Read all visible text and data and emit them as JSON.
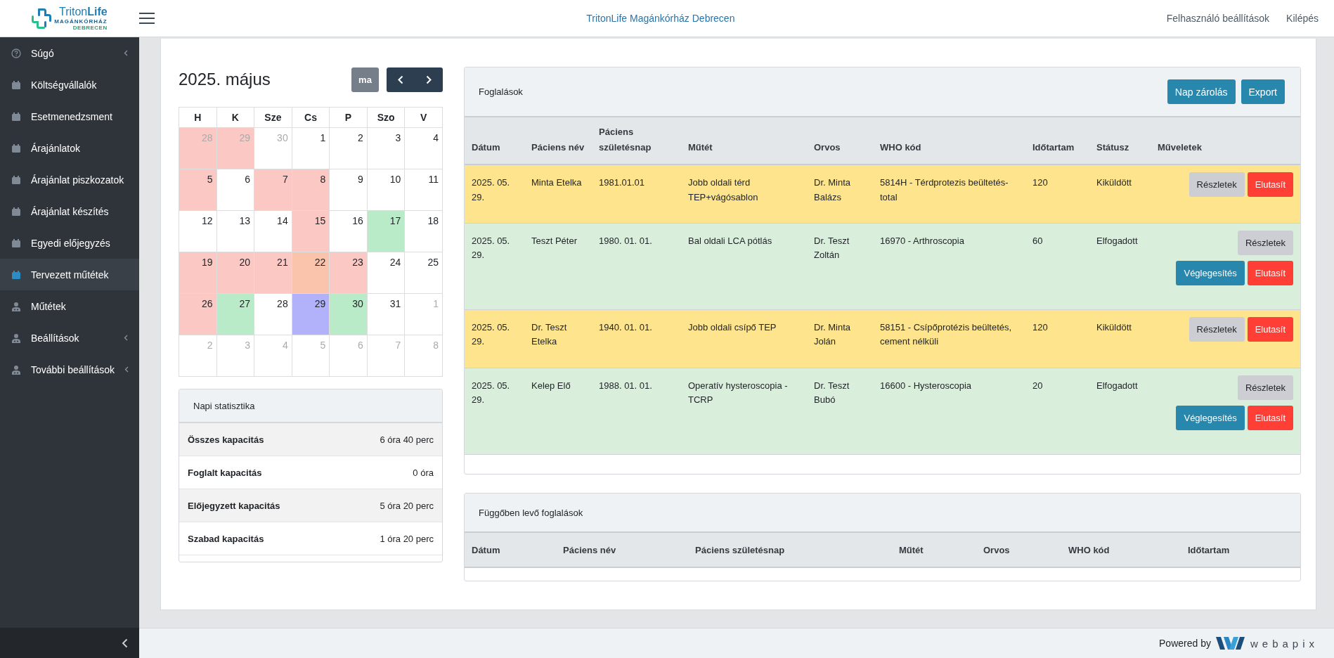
{
  "header": {
    "logo": {
      "name": "Triton**Life**",
      "subtitle": "MAGÁNKÓRHÁZ",
      "city": "DEBRECEN"
    },
    "title": "TritonLife Magánkórház Debrecen",
    "links": [
      "Felhasználó beállítások",
      "Kilépés"
    ]
  },
  "sidebar": {
    "items": [
      {
        "label": "Súgó",
        "kind": "help",
        "expandable": true,
        "selected": false
      },
      {
        "label": "Költségvállalók",
        "kind": "calendar",
        "expandable": false,
        "selected": false
      },
      {
        "label": "Esetmenedzsment",
        "kind": "calendar",
        "expandable": false,
        "selected": false
      },
      {
        "label": "Árajánlatok",
        "kind": "calendar",
        "expandable": false,
        "selected": false
      },
      {
        "label": "Árajánlat piszkozatok",
        "kind": "calendar",
        "expandable": false,
        "selected": false
      },
      {
        "label": "Árajánlat készítés",
        "kind": "calendar",
        "expandable": false,
        "selected": false
      },
      {
        "label": "Egyedi előjegyzés",
        "kind": "calendar",
        "expandable": false,
        "selected": false
      },
      {
        "label": "Tervezett műtétek",
        "kind": "calendar",
        "expandable": false,
        "selected": true
      },
      {
        "label": "Műtétek",
        "kind": "doctor",
        "expandable": false,
        "selected": false
      },
      {
        "label": "Beállítások",
        "kind": "doctor",
        "expandable": true,
        "selected": false
      },
      {
        "label": "További beállítások",
        "kind": "doctor",
        "expandable": true,
        "selected": false
      }
    ]
  },
  "calendar": {
    "title": "2025. május",
    "today_button": "ma",
    "weekdays": [
      "H",
      "K",
      "Sze",
      "Cs",
      "P",
      "Szo",
      "V"
    ],
    "weeks": [
      [
        {
          "day": "28",
          "outside": true,
          "color": "#fbc8c4"
        },
        {
          "day": "29",
          "outside": true,
          "color": "#fbc8c4"
        },
        {
          "day": "30",
          "outside": true
        },
        {
          "day": "1",
          "outside": false
        },
        {
          "day": "2",
          "outside": false
        },
        {
          "day": "3",
          "outside": false
        },
        {
          "day": "4",
          "outside": false
        }
      ],
      [
        {
          "day": "5",
          "outside": false,
          "color": "#fbc8c4"
        },
        {
          "day": "6",
          "outside": false
        },
        {
          "day": "7",
          "outside": false,
          "color": "#fbc8c4"
        },
        {
          "day": "8",
          "outside": false,
          "color": "#fbc8c4"
        },
        {
          "day": "9",
          "outside": false
        },
        {
          "day": "10",
          "outside": false
        },
        {
          "day": "11",
          "outside": false
        }
      ],
      [
        {
          "day": "12",
          "outside": false
        },
        {
          "day": "13",
          "outside": false
        },
        {
          "day": "14",
          "outside": false
        },
        {
          "day": "15",
          "outside": false,
          "color": "#fbc8c4"
        },
        {
          "day": "16",
          "outside": false
        },
        {
          "day": "17",
          "outside": false,
          "color": "#b9ebc9"
        },
        {
          "day": "18",
          "outside": false
        }
      ],
      [
        {
          "day": "19",
          "outside": false,
          "color": "#fbc8c4"
        },
        {
          "day": "20",
          "outside": false,
          "color": "#fbc8c4"
        },
        {
          "day": "21",
          "outside": false,
          "color": "#fbc8c4"
        },
        {
          "day": "22",
          "outside": false,
          "color": "#f9c4ab"
        },
        {
          "day": "23",
          "outside": false,
          "color": "#fbc8c4"
        },
        {
          "day": "24",
          "outside": false
        },
        {
          "day": "25",
          "outside": false
        }
      ],
      [
        {
          "day": "26",
          "outside": false,
          "color": "#fbc8c4"
        },
        {
          "day": "27",
          "outside": false,
          "color": "#b9ebc9"
        },
        {
          "day": "28",
          "outside": false
        },
        {
          "day": "29",
          "outside": false,
          "color": "#b2b2fb"
        },
        {
          "day": "30",
          "outside": false,
          "color": "#b9ebc9"
        },
        {
          "day": "31",
          "outside": false
        },
        {
          "day": "1",
          "outside": true
        }
      ],
      [
        {
          "day": "2",
          "outside": true
        },
        {
          "day": "3",
          "outside": true
        },
        {
          "day": "4",
          "outside": true
        },
        {
          "day": "5",
          "outside": true
        },
        {
          "day": "6",
          "outside": true
        },
        {
          "day": "7",
          "outside": true
        },
        {
          "day": "8",
          "outside": true
        }
      ]
    ]
  },
  "stats": {
    "title": "Napi statisztika",
    "rows": [
      {
        "label": "Összes kapacitás",
        "value": "6 óra 40 perc"
      },
      {
        "label": "Foglalt kapacitás",
        "value": "0 óra"
      },
      {
        "label": "Előjegyzett kapacitás",
        "value": "5 óra 20 perc"
      },
      {
        "label": "Szabad kapacitás",
        "value": "1 óra 20 perc"
      }
    ]
  },
  "bookings": {
    "title": "Foglalások",
    "buttons": [
      "Nap zárolás",
      "Export"
    ],
    "columns": [
      "Dátum",
      "Páciens név",
      "Páciens születésnap",
      "Műtét",
      "Orvos",
      "WHO kód",
      "Időtartam",
      "Státusz",
      "Műveletek"
    ],
    "rows": [
      {
        "color": "#fee58d",
        "cells": [
          "2025. 05. 29.",
          "Minta Etelka",
          "1981.01.01",
          "Jobb oldali térd TEP+vágósablon",
          "Dr. Minta Balázs",
          "5814H - Térdprotezis beültetés-total",
          "120",
          "Kiküldött"
        ],
        "actions": [
          {
            "kind": "details",
            "label": "Részletek"
          },
          {
            "kind": "reject",
            "label": "Elutasít"
          }
        ]
      },
      {
        "color": "#d9efdb",
        "cells": [
          "2025. 05. 29.",
          "Teszt Péter",
          "1980. 01. 01.",
          "Bal oldali LCA pótlás",
          "Dr. Teszt Zoltán",
          "16970 - Arthroscopia",
          "60",
          "Elfogadott"
        ],
        "actions": [
          {
            "kind": "details",
            "label": "Részletek"
          },
          {
            "kind": "finalize",
            "label": "Véglegesítés"
          },
          {
            "kind": "reject",
            "label": "Elutasít"
          }
        ]
      },
      {
        "color": "#fee58d",
        "cells": [
          "2025. 05. 29.",
          "Dr. Teszt Etelka",
          "1940. 01. 01.",
          "Jobb oldali csípő TEP",
          "Dr. Minta Jolán",
          "58151 - Csípőprotézis beültetés, cement nélküli",
          "120",
          "Kiküldött"
        ],
        "actions": [
          {
            "kind": "details",
            "label": "Részletek"
          },
          {
            "kind": "reject",
            "label": "Elutasít"
          }
        ]
      },
      {
        "color": "#d9efdb",
        "cells": [
          "2025. 05. 29.",
          "Kelep Elő",
          "1988. 01. 01.",
          "Operatív hysteroscopia - TCRP",
          "Dr. Teszt Bubó",
          "16600 - Hysteroscopia",
          "20",
          "Elfogadott"
        ],
        "actions": [
          {
            "kind": "details",
            "label": "Részletek"
          },
          {
            "kind": "finalize",
            "label": "Véglegesítés"
          },
          {
            "kind": "reject",
            "label": "Elutasít"
          }
        ]
      }
    ]
  },
  "pending": {
    "title": "Függőben levő foglalások",
    "columns": [
      "Dátum",
      "Páciens név",
      "Páciens születésnap",
      "Műtét",
      "Orvos",
      "WHO kód",
      "Időtartam"
    ]
  },
  "footer": {
    "powered_by": "Powered by",
    "brand": "webapix"
  }
}
